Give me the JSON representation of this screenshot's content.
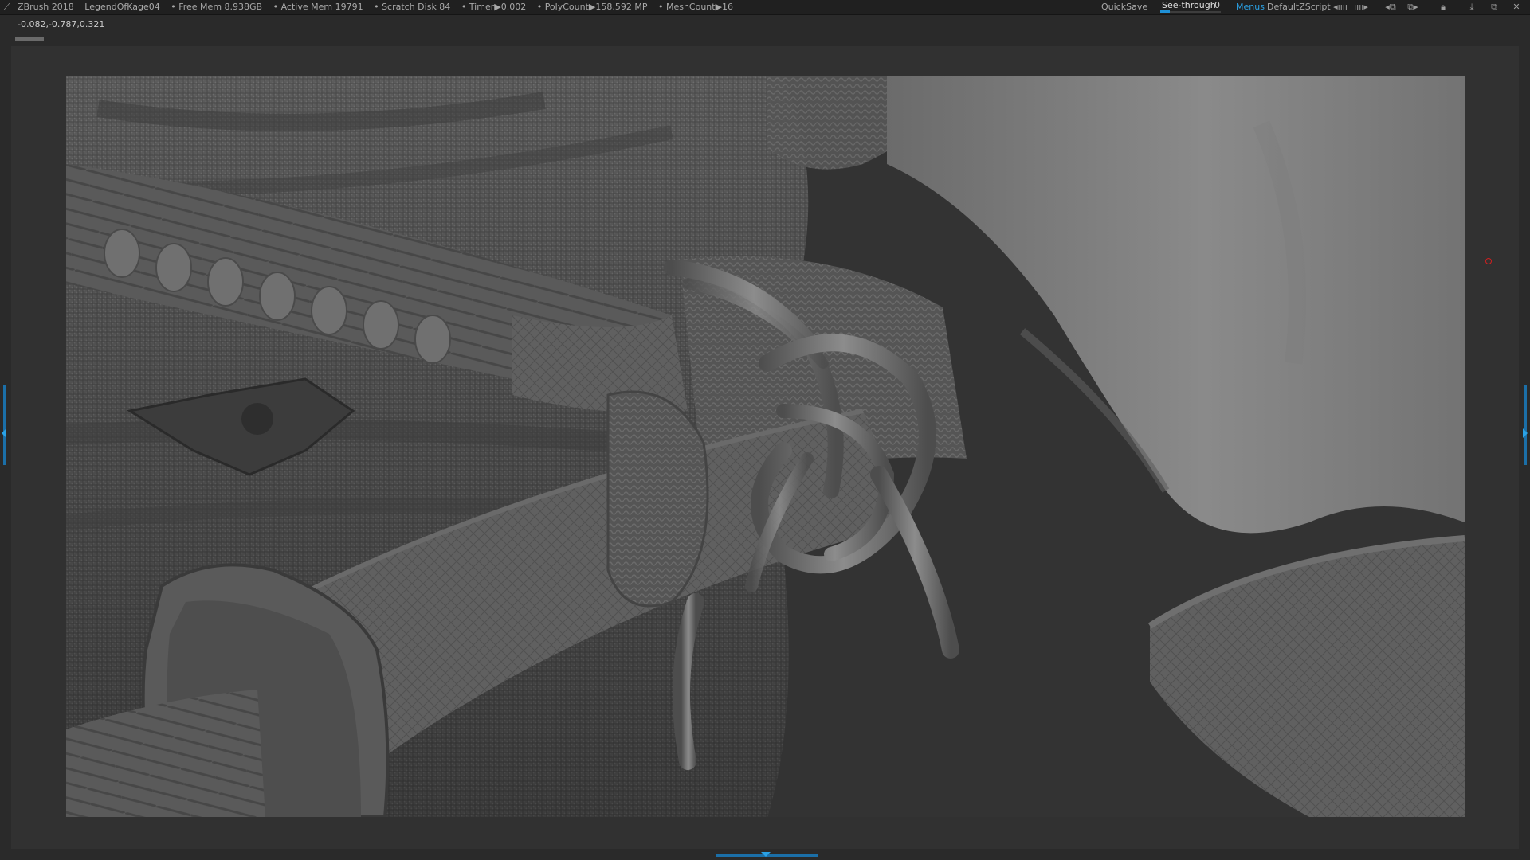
{
  "app": {
    "name": "ZBrush 2018",
    "document": "LegendOfKage04"
  },
  "status": {
    "free_mem": "• Free Mem 8.938GB",
    "active_mem": "• Active Mem 19791",
    "scratch_disk": "• Scratch Disk 84",
    "timer": "• Timer▶0.002",
    "polycount": "• PolyCount▶158.592 MP",
    "meshcount": "• MeshCount▶16"
  },
  "toolbar": {
    "quicksave_label": "QuickSave",
    "seethrough_label": "See-through",
    "seethrough_value": "0",
    "seethrough_level": 0.0,
    "menus_label": "Menus",
    "script_label": "DefaultZScript"
  },
  "icons": {
    "logo": "zbrush-logo-icon",
    "palette_left": "palette-left-icon",
    "palette_right": "palette-right-icon",
    "layout_1": "layout-icon",
    "layout_2": "layout-swap-icon",
    "lock": "lock-icon",
    "minimize": "minimize-icon",
    "restore": "restore-icon",
    "close": "close-icon"
  },
  "readout": {
    "coordinates": "-0.082,-0.787,0.321"
  },
  "colors": {
    "accent": "#2aa2e6",
    "background": "#2a2a2a",
    "marker": "#d02020"
  }
}
